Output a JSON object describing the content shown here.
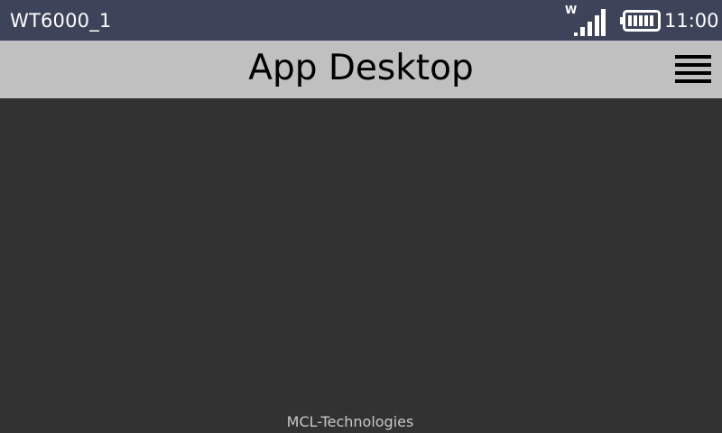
{
  "status_bar": {
    "device_name": "WT6000_1",
    "signal_letter": "W",
    "signal_icon": "signal-bars-icon",
    "battery_icon": "battery-full-icon",
    "time": "11:00"
  },
  "header": {
    "title": "App Desktop",
    "menu_icon": "hamburger-menu-icon"
  },
  "footer": {
    "brand": "MCL-Technologies"
  },
  "colors": {
    "status_bar_bg": "#3d4359",
    "header_bg": "#c0c0c0",
    "content_bg": "#323232",
    "footer_text": "#c8c8c8"
  }
}
